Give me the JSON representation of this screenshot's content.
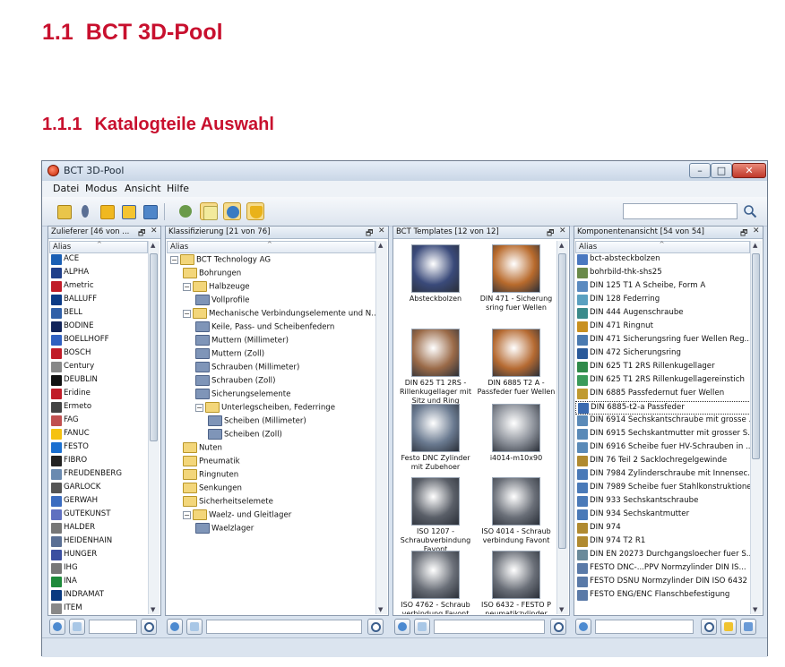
{
  "doc": {
    "h1_num": "1.1",
    "h1_text": "BCT 3D-Pool",
    "h2_num": "1.1.1",
    "h2_text": "Katalogteile Auswahl"
  },
  "window": {
    "title": "BCT 3D-Pool",
    "min": "–",
    "max": "□",
    "close": "✕"
  },
  "menu": [
    "Datei",
    "Modus",
    "Ansicht",
    "Hilfe"
  ],
  "panels": {
    "zulieferer": {
      "title": "Zulieferer  [46 von ...",
      "column": "Alias",
      "items": [
        "ACE",
        "ALPHA",
        "Ametric",
        "BALLUFF",
        "BELL",
        "BODINE",
        "BOELLHOFF",
        "BOSCH",
        "Century",
        "DEUBLIN",
        "Eridine",
        "Ermeto",
        "FAG",
        "FANUC",
        "FESTO",
        "FIBRO",
        "FREUDENBERG",
        "GARLOCK",
        "GERWAH",
        "GUTEKUNST",
        "HALDER",
        "HEIDENHAIN",
        "HUNGER",
        "IHG",
        "INA",
        "INDRAMAT",
        "ITEM"
      ]
    },
    "klassifizierung": {
      "title": "Klassifizierung  [21 von 76]",
      "column": "Alias",
      "tree": [
        {
          "label": "BCT Technology AG",
          "level": 0,
          "exp": "−"
        },
        {
          "label": "Bohrungen",
          "level": 1,
          "exp": ""
        },
        {
          "label": "Halbzeuge",
          "level": 1,
          "exp": "−"
        },
        {
          "label": "Vollprofile",
          "level": 2,
          "exp": ""
        },
        {
          "label": "Mechanische Verbindungselemente und N...",
          "level": 1,
          "exp": "−"
        },
        {
          "label": "Keile, Pass- und Scheibenfedern",
          "level": 2,
          "exp": ""
        },
        {
          "label": "Muttern (Millimeter)",
          "level": 2,
          "exp": ""
        },
        {
          "label": "Muttern (Zoll)",
          "level": 2,
          "exp": ""
        },
        {
          "label": "Schrauben (Millimeter)",
          "level": 2,
          "exp": ""
        },
        {
          "label": "Schrauben (Zoll)",
          "level": 2,
          "exp": ""
        },
        {
          "label": "Sicherungselemente",
          "level": 2,
          "exp": ""
        },
        {
          "label": "Unterlegscheiben, Federringe",
          "level": 2,
          "exp": "−"
        },
        {
          "label": "Scheiben (Millimeter)",
          "level": 3,
          "exp": ""
        },
        {
          "label": "Scheiben (Zoll)",
          "level": 3,
          "exp": ""
        },
        {
          "label": "Nuten",
          "level": 1,
          "exp": ""
        },
        {
          "label": "Pneumatik",
          "level": 1,
          "exp": ""
        },
        {
          "label": "Ringnuten",
          "level": 1,
          "exp": ""
        },
        {
          "label": "Senkungen",
          "level": 1,
          "exp": ""
        },
        {
          "label": "Sicherheitselemete",
          "level": 1,
          "exp": ""
        },
        {
          "label": "Waelz- und Gleitlager",
          "level": 1,
          "exp": "−"
        },
        {
          "label": "Waelzlager",
          "level": 2,
          "exp": ""
        }
      ]
    },
    "templates": {
      "title": "BCT Templates  [12 von 12]",
      "items": [
        {
          "label": "Absteckbolzen",
          "color": "#3a4a7a"
        },
        {
          "label": "DIN 471 - Sicherung sring fuer Wellen",
          "color": "#b86a2c"
        },
        {
          "label": "DIN 625 T1 2RS - Rillenkugellager mit Sitz und Ring",
          "color": "#9a6a48"
        },
        {
          "label": "DIN 6885 T2 A - Passfeder fuer Wellen",
          "color": "#b56a32"
        },
        {
          "label": "Festo DNC Zylinder mit Zubehoer",
          "color": "#6a7a90"
        },
        {
          "label": "i4014-m10x90",
          "color": "#8a8f98"
        },
        {
          "label": "ISO 1207 - Schraubverbindung Favont",
          "color": "#5a5f68"
        },
        {
          "label": "ISO 4014 - Schraub verbindung Favont",
          "color": "#6a6f78"
        },
        {
          "label": "ISO 4762 - Schraub verbindung Favont",
          "color": "#6a6f78"
        },
        {
          "label": "ISO 6432 - FESTO P neumatikzylinder",
          "color": "#6a6f78"
        }
      ]
    },
    "komponenten": {
      "title": "Komponentenansicht  [54 von 54]",
      "column": "Alias",
      "items": [
        "bct-absteckbolzen",
        "bohrbild-thk-shs25",
        "DIN 125 T1 A Scheibe, Form A",
        "DIN 128 Federring",
        "DIN 444 Augenschraube",
        "DIN 471 Ringnut",
        "DIN 471 Sicherungsring fuer Wellen Reg...",
        "DIN 472 Sicherungsring",
        "DIN 625 T1 2RS Rillenkugellager",
        "DIN 625 T1 2RS Rillenkugellagereinstich",
        "DIN 6885 Passfedernut fuer Wellen",
        "DIN 6885-t2-a Passfeder",
        "DIN 6914 Sechskantschraube mit grosse ...",
        "DIN 6915 Sechskantmutter mit grosser S...",
        "DIN 6916 Scheibe fuer HV-Schrauben in ...",
        "DIN 76 Teil 2 Sacklochregelgewinde",
        "DIN 7984 Zylinderschraube mit Innensec...",
        "DIN 7989 Scheibe fuer Stahlkonstruktionen",
        "DIN 933 Sechskantschraube",
        "DIN 934 Sechskantmutter",
        "DIN 974",
        "DIN 974 T2 R1",
        "DIN EN 20273 Durchgangsloecher fuer S...",
        "FESTO DNC-...PPV Normzylinder DIN IS...",
        "FESTO DSNU Normzylinder DIN ISO 6432",
        "FESTO ENG/ENC Flanschbefestigung"
      ]
    }
  },
  "colors": {
    "heading": "#c8102e",
    "window_bg": "#d9e3ef",
    "toolbar_active": "#f6dc8c"
  },
  "icons": {
    "toolbar": [
      "open-folder-icon",
      "pin-icon",
      "yellow-part-icon",
      "yellow-assembly-icon",
      "broom-icon",
      "users-icon",
      "star-tile-icon",
      "blue-disk-icon",
      "yellow-shield-icon"
    ],
    "search": "search-icon",
    "footer": [
      "round-button-icon",
      "square-button-icon",
      "search-icon",
      "cad-icon",
      "export-icon"
    ]
  }
}
